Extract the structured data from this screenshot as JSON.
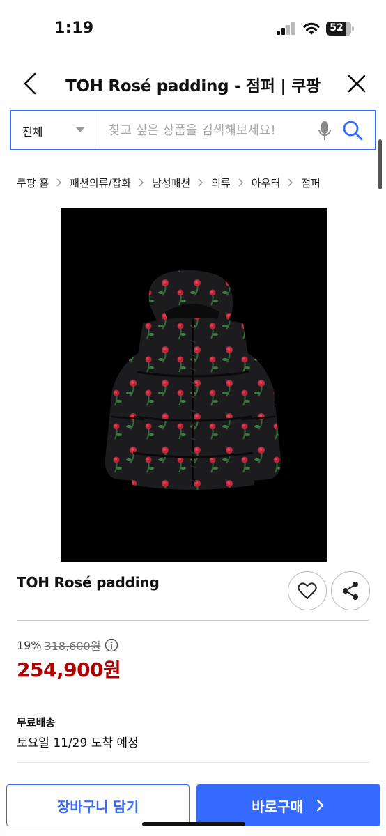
{
  "status_bar": {
    "time": "1:19",
    "battery": "52"
  },
  "header": {
    "title": "TOH Rosé padding - 점퍼 | 쿠팡"
  },
  "search": {
    "category": "전체",
    "placeholder": "찾고 싶은 상품을 검색해보세요!"
  },
  "breadcrumb": [
    "쿠팡 홈",
    "패션의류/잡화",
    "남성패션",
    "의류",
    "아우터",
    "점퍼"
  ],
  "product": {
    "name": "TOH Rosé padding",
    "discount_rate": "19%",
    "original_price": "318,600원",
    "sale_price": "254,900원",
    "shipping_label": "무료배송",
    "arrival": "토요일 11/29 도착 예정"
  },
  "actions": {
    "cart_label": "장바구니 담기",
    "buy_label": "바로구매"
  },
  "colors": {
    "accent": "#346aff",
    "price": "#ae0000"
  },
  "icons": [
    "back-icon",
    "close-icon",
    "caret-icon",
    "mic-icon",
    "search-icon",
    "heart-icon",
    "share-icon",
    "info-icon",
    "chevron-right-icon"
  ]
}
